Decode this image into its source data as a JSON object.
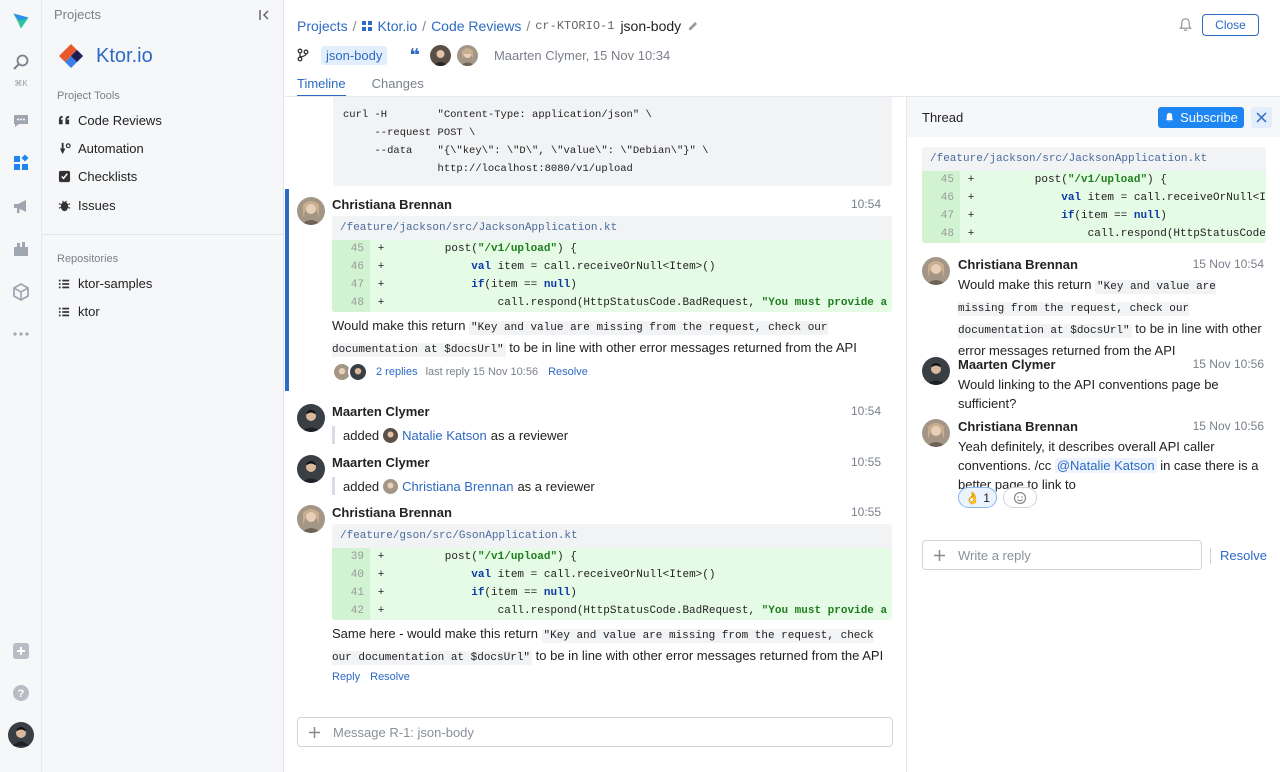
{
  "rail": {
    "shortcut": "⌘K",
    "icons": [
      "app-logo",
      "search-icon",
      "chat-icon",
      "apps-icon",
      "megaphone-icon",
      "planning-icon",
      "packages-icon",
      "more-icon",
      "add-icon",
      "help-icon",
      "user-avatar"
    ]
  },
  "sidebar": {
    "header": "Projects",
    "project_name": "Ktor.io",
    "tools_title": "Project Tools",
    "tools": [
      {
        "label": "Code Reviews",
        "icon": "quote-icon"
      },
      {
        "label": "Automation",
        "icon": "automation-icon"
      },
      {
        "label": "Checklists",
        "icon": "checklist-icon"
      },
      {
        "label": "Issues",
        "icon": "bug-icon"
      }
    ],
    "repos_title": "Repositories",
    "repos": [
      {
        "label": "ktor-samples",
        "icon": "repo-icon"
      },
      {
        "label": "ktor",
        "icon": "repo-icon"
      }
    ]
  },
  "header": {
    "crumb_projects": "Projects",
    "crumb_project": "Ktor.io",
    "crumb_reviews": "Code Reviews",
    "review_id": "cr-KTORIO-1",
    "review_title": "json-body",
    "close_label": "Close",
    "branch": "json-body",
    "author_meta": "Maarten Clymer, 15 Nov 10:34",
    "tabs": [
      "Timeline",
      "Changes"
    ]
  },
  "timeline": {
    "curl_lines": [
      "curl -H        \"Content-Type: application/json\" \\",
      "     --request POST \\",
      "     --data    \"{\\\"key\\\": \\\"D\\\", \\\"value\\\": \\\"Debian\\\"}\" \\",
      "               http://localhost:8080/v1/upload"
    ],
    "comment1": {
      "author": "Christiana Brennan",
      "time": "10:54",
      "file": "/feature/jackson/src/JacksonApplication.kt",
      "lines": [
        "45",
        "46",
        "47",
        "48"
      ],
      "text_before": "Would make this return ",
      "code": "\"Key and value are missing from the request, check our documentation at $docsUrl\"",
      "text_after": " to be in line with other error messages returned from the API",
      "replies": "2 replies",
      "last_reply": "last reply 15 Nov 10:56",
      "resolve": "Resolve"
    },
    "event1": {
      "author": "Maarten Clymer",
      "time": "10:54",
      "action": "added",
      "target": "Natalie Katson",
      "suffix": "as a reviewer"
    },
    "event2": {
      "author": "Maarten Clymer",
      "time": "10:55",
      "action": "added",
      "target": "Christiana Brennan",
      "suffix": "as a reviewer"
    },
    "comment2": {
      "author": "Christiana Brennan",
      "time": "10:55",
      "file": "/feature/gson/src/GsonApplication.kt",
      "lines": [
        "39",
        "40",
        "41",
        "42"
      ],
      "text_before": "Same here - would make this return ",
      "code": "\"Key and value are missing from the request, check our documentation at $docsUrl\"",
      "text_after": " to be in line with other error messages returned from the API",
      "reply": "Reply",
      "resolve": "Resolve"
    },
    "message_placeholder": "Message R-1: json-body"
  },
  "thread": {
    "title": "Thread",
    "subscribe": "Subscribe",
    "file": "/feature/jackson/src/JacksonApplication.kt",
    "lines": [
      "45",
      "46",
      "47",
      "48"
    ],
    "messages": [
      {
        "author": "Christiana Brennan",
        "time": "15 Nov 10:54",
        "text_before": "Would make this return ",
        "code": "\"Key and value are missing from the request, check our documentation at $docsUrl\"",
        "text_after": " to be in line with other error messages returned from the API"
      },
      {
        "author": "Maarten Clymer",
        "time": "15 Nov 10:56",
        "text": "Would linking to the API conventions page be sufficient?"
      },
      {
        "author": "Christiana Brennan",
        "time": "15 Nov 10:56",
        "text_before": "Yeah definitely, it describes overall API caller conventions. /cc ",
        "mention": "@Natalie Katson",
        "text_after": " in case there is a better page to link to",
        "reaction_emoji": "👌",
        "reaction_count": "1"
      }
    ],
    "reply_placeholder": "Write a reply",
    "resolve": "Resolve"
  },
  "colors": {
    "accent": "#2d6ac3",
    "subscribe": "#1e86f2",
    "diff_bg": "#e6fbe6"
  }
}
